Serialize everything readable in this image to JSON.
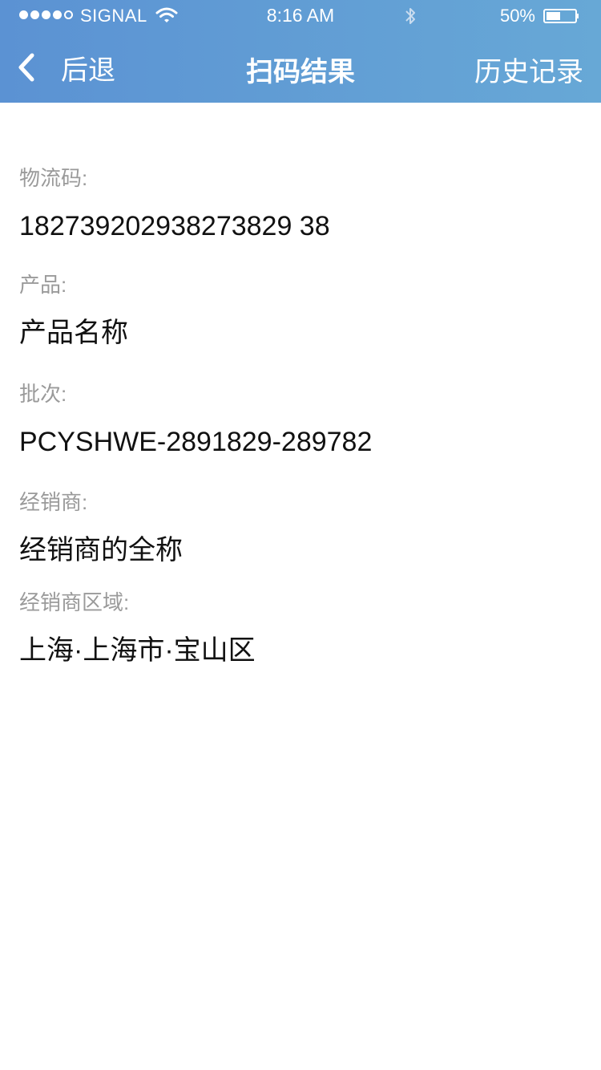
{
  "status_bar": {
    "carrier": "SIGNAL",
    "time": "8:16 AM",
    "battery": "50%",
    "battery_level": 0.5,
    "signal_bars": 4,
    "signal_total": 5
  },
  "nav": {
    "back_label": "后退",
    "title": "扫码结果",
    "history_label": "历史记录"
  },
  "fields": [
    {
      "label": "物流码:",
      "value": "182739202938273829 38"
    },
    {
      "label": "产品:",
      "value": "产品名称"
    },
    {
      "label": "批次:",
      "value": "PCYSHWE-2891829-289782"
    },
    {
      "label": "经销商:",
      "value": "经销商的全称"
    },
    {
      "label": "经销商区域:",
      "value": "上海·上海市·宝山区"
    }
  ],
  "colors": {
    "nav_start": "#5b92d3",
    "nav_end": "#67a8d6",
    "label": "#9a9a9a",
    "value": "#111111"
  }
}
